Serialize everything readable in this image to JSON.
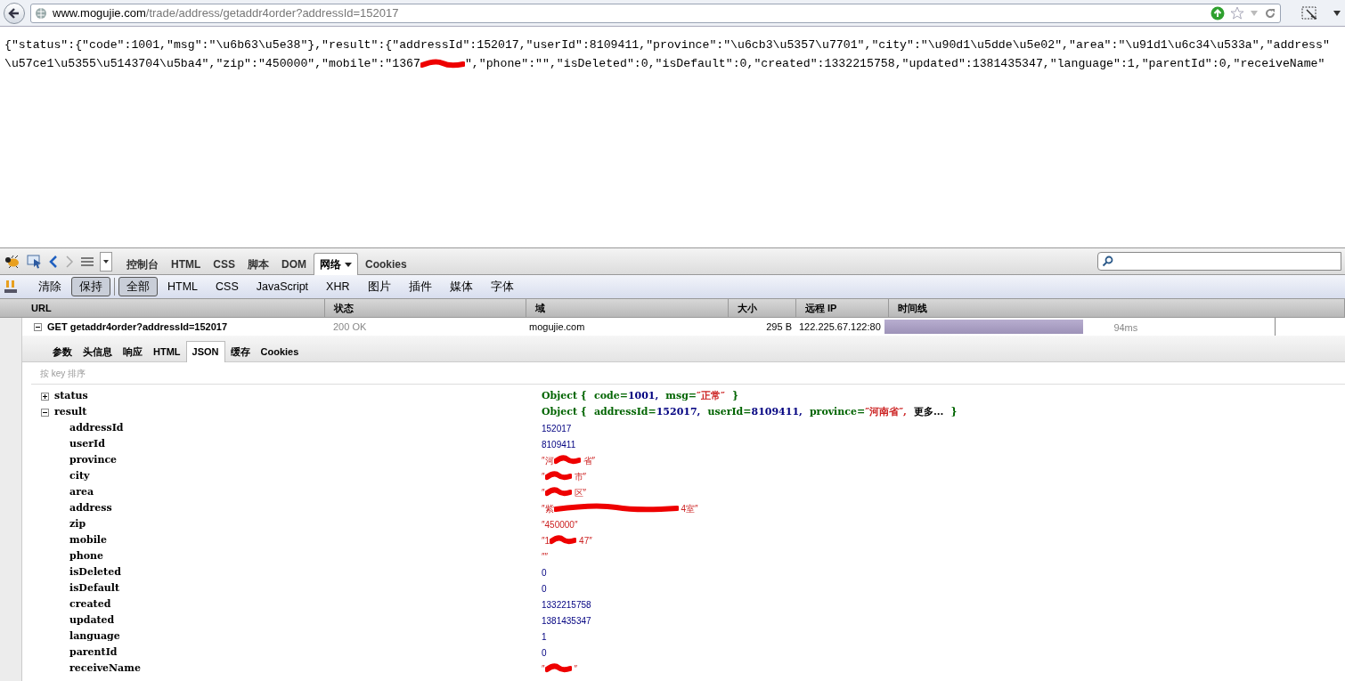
{
  "address_bar": {
    "host": "www.mogujie.com",
    "path": "/trade/address/getaddr4order?addressId=152017"
  },
  "page_text": {
    "line_1": "{\"status\":{\"code\":1001,\"msg\":\"\\u6b63\\u5e38\"},\"result\":{\"addressId\":152017,\"userId\":8109411,\"province\":\"\\u6cb3\\u5357\\u7701\",\"city\":\"\\u90d1\\u5dde\\u5e02\",\"area\":\"\\u91d1\\u6c34\\u533a\",\"address\"",
    "line_2_start": "\\u57ce1\\u5355\\u5143704\\u5ba4\",\"zip\":\"450000\",\"mobile\":\"1367",
    "line_2_end": "\",\"phone\":\"\",\"isDeleted\":0,\"isDefault\":0,\"created\":1332215758,\"updated\":1381435347,\"language\":1,\"parentId\":0,\"receiveName\""
  },
  "firebug": {
    "tabs": [
      {
        "label": "控制台",
        "selected": false,
        "has_menu": false
      },
      {
        "label": "HTML",
        "selected": false,
        "has_menu": false
      },
      {
        "label": "CSS",
        "selected": false,
        "has_menu": false
      },
      {
        "label": "脚本",
        "selected": false,
        "has_menu": false
      },
      {
        "label": "DOM",
        "selected": false,
        "has_menu": false
      },
      {
        "label": "网络",
        "selected": true,
        "has_menu": true
      },
      {
        "label": "Cookies",
        "selected": false,
        "has_menu": false
      }
    ],
    "actions": [
      {
        "label": "清除",
        "pressed": false
      },
      {
        "label": "保持",
        "pressed": true
      }
    ],
    "filters": [
      {
        "label": "全部",
        "selected": true
      },
      {
        "label": "HTML",
        "selected": false
      },
      {
        "label": "CSS",
        "selected": false
      },
      {
        "label": "JavaScript",
        "selected": false
      },
      {
        "label": "XHR",
        "selected": false
      },
      {
        "label": "图片",
        "selected": false
      },
      {
        "label": "插件",
        "selected": false
      },
      {
        "label": "媒体",
        "selected": false
      },
      {
        "label": "字体",
        "selected": false
      }
    ],
    "columns": [
      "URL",
      "状态",
      "域",
      "大小",
      "远程 IP",
      "时间线"
    ],
    "request": {
      "label": "GET getaddr4order?addressId=152017",
      "expanded": true,
      "status": "200 OK",
      "domain": "mogujie.com",
      "size": "295 B",
      "remote_ip": "122.225.67.122:80",
      "time": "94ms",
      "level": 0.51
    },
    "subtabs": [
      {
        "label": "参数",
        "selected": false
      },
      {
        "label": "头信息",
        "selected": false
      },
      {
        "label": "响应",
        "selected": false
      },
      {
        "label": "HTML",
        "selected": false
      },
      {
        "label": "JSON",
        "selected": true
      },
      {
        "label": "缓存",
        "selected": false
      },
      {
        "label": "Cookies",
        "selected": false
      }
    ],
    "sort_hint": "按 key 排序",
    "tree": [
      {
        "key": "status",
        "expanded": false,
        "prefix": "Object {",
        "summary": [
          {
            "key": "code=",
            "value": "1001,",
            "kind": "number"
          },
          {
            "key": "msg=",
            "value": "″正常″",
            "kind": "string"
          }
        ],
        "suffix": "}"
      },
      {
        "key": "result",
        "expanded": true,
        "prefix": "Object {",
        "summary": [
          {
            "key": "addressId=",
            "value": "152017,",
            "kind": "number"
          },
          {
            "key": "userId=",
            "value": "8109411,",
            "kind": "number"
          },
          {
            "key": "province=",
            "value": "″河南省″,",
            "kind": "string"
          }
        ],
        "more": "更多...",
        "suffix": "}",
        "children": [
          {
            "key": "addressId",
            "kind": "number",
            "parts": [
              "152017"
            ]
          },
          {
            "key": "userId",
            "kind": "number",
            "parts": [
              "8109411"
            ]
          },
          {
            "key": "province",
            "kind": "string",
            "parts": [
              "″河",
              "省″"
            ]
          },
          {
            "key": "city",
            "kind": "string",
            "parts": [
              "″",
              "市″"
            ]
          },
          {
            "key": "area",
            "kind": "string",
            "parts": [
              "″",
              "区″"
            ]
          },
          {
            "key": "address",
            "kind": "string",
            "parts": [
              "″紫",
              "4室″"
            ]
          },
          {
            "key": "zip",
            "kind": "string",
            "parts": [
              "″450000″"
            ]
          },
          {
            "key": "mobile",
            "kind": "string",
            "parts": [
              "″1",
              "47″"
            ]
          },
          {
            "key": "phone",
            "kind": "string",
            "parts": [
              "″″"
            ]
          },
          {
            "key": "isDeleted",
            "kind": "number",
            "parts": [
              "0"
            ]
          },
          {
            "key": "isDefault",
            "kind": "number",
            "parts": [
              "0"
            ]
          },
          {
            "key": "created",
            "kind": "number",
            "parts": [
              "1332215758"
            ]
          },
          {
            "key": "updated",
            "kind": "number",
            "parts": [
              "1381435347"
            ]
          },
          {
            "key": "language",
            "kind": "number",
            "parts": [
              "1"
            ]
          },
          {
            "key": "parentId",
            "kind": "number",
            "parts": [
              "0"
            ]
          },
          {
            "key": "receiveName",
            "kind": "string",
            "parts": [
              "″",
              "″"
            ]
          }
        ]
      }
    ]
  }
}
